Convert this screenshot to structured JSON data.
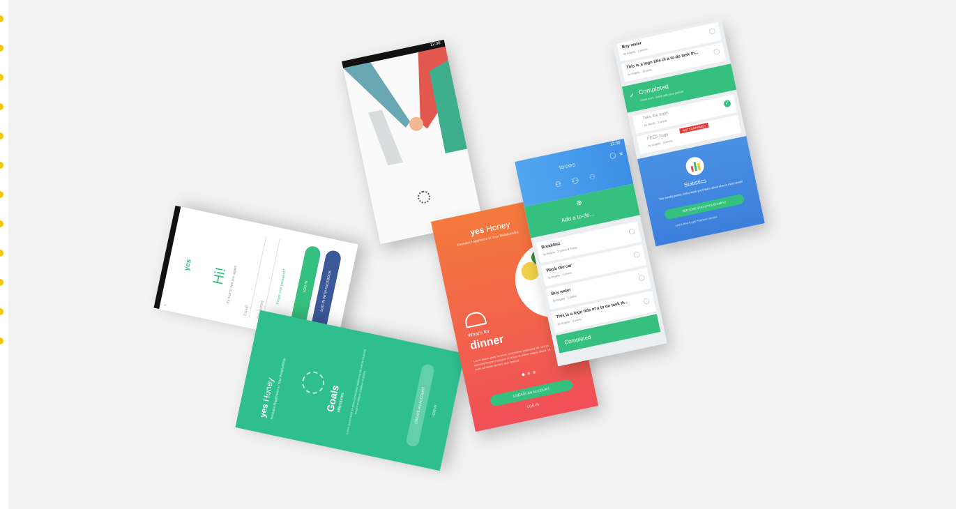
{
  "brand": {
    "mark": "yes",
    "name": "Honey",
    "tagline": "Increase Happiness in Your Relationship"
  },
  "login": {
    "logo_mark": "yes",
    "greeting": "Hi!",
    "subtitle": "it's nice to see you again!",
    "email_placeholder": "Email",
    "password_placeholder": "Password",
    "forgot": "Forgot your password?",
    "login_button": "LOG IN",
    "facebook_button": "LOG IN WITH FACEBOOK"
  },
  "splash": {
    "time": "12:30"
  },
  "goals": {
    "title": "Goals",
    "subtitle": "Milestones",
    "body": "Lorem ipsum dolor sit amet consectetur adipiscing elit sed do eiusmod tempor incididunt ut labore et dolore",
    "create_button": "CREATE AN ACCOUNT",
    "login_link": "LOG IN"
  },
  "dinner": {
    "question": "What's for",
    "highlight": "dinner",
    "body": "Lorem ipsum dolor sit amet, consectetur adipiscing elit, sed do eiusmod tempor incididunt ut labore et dolore magna aliqua. Ut enim ad minim veniam, quis nostrud",
    "create_button": "CREATE AN ACCOUNT",
    "login_link": "LOG IN"
  },
  "todo": {
    "time": "12:30",
    "header_title": "TO DO'S",
    "add_label": "Add a to-do...",
    "items": [
      {
        "title": "Breakfast",
        "meta": "by Angela · 2 points  ♥ Today"
      },
      {
        "title": "Wash the car",
        "meta": "by Angela · 3 points"
      },
      {
        "title": "Buy water",
        "meta": "by Angela · 3 points"
      },
      {
        "title": "This is a logn title of a to do task th...",
        "meta": "by Angela · 3 points"
      }
    ],
    "completed_label": "Completed"
  },
  "todo2": {
    "items": [
      {
        "title": "Buy water",
        "meta": "by Angela · 2 points"
      },
      {
        "title": "This is a logn title of a to do task th...",
        "meta": "by Angela · 3 points"
      }
    ],
    "completed_title": "Completed",
    "completed_sub": "Great work, check with your partner",
    "done_items": [
      {
        "title": "Take the trash",
        "meta": "by Jacob · 2 points"
      },
      {
        "title": "FEED bugs",
        "meta": "by Angela · 3 points"
      }
    ],
    "red_tag": "NOT CONFIRMED",
    "stats_title": "Statistics",
    "stats_text": "Your weekly points, every week you'll learn about what is most needs!",
    "stats_button": "SEE SOME STATISTICS EXAMPLE",
    "stats_link": "Learn how to get Premium Version"
  },
  "colors": {
    "green": "#35c07f",
    "coral": "#f2604f",
    "blue": "#3d8ee8",
    "facebook": "#3b5998",
    "dot": "#f6c600"
  }
}
